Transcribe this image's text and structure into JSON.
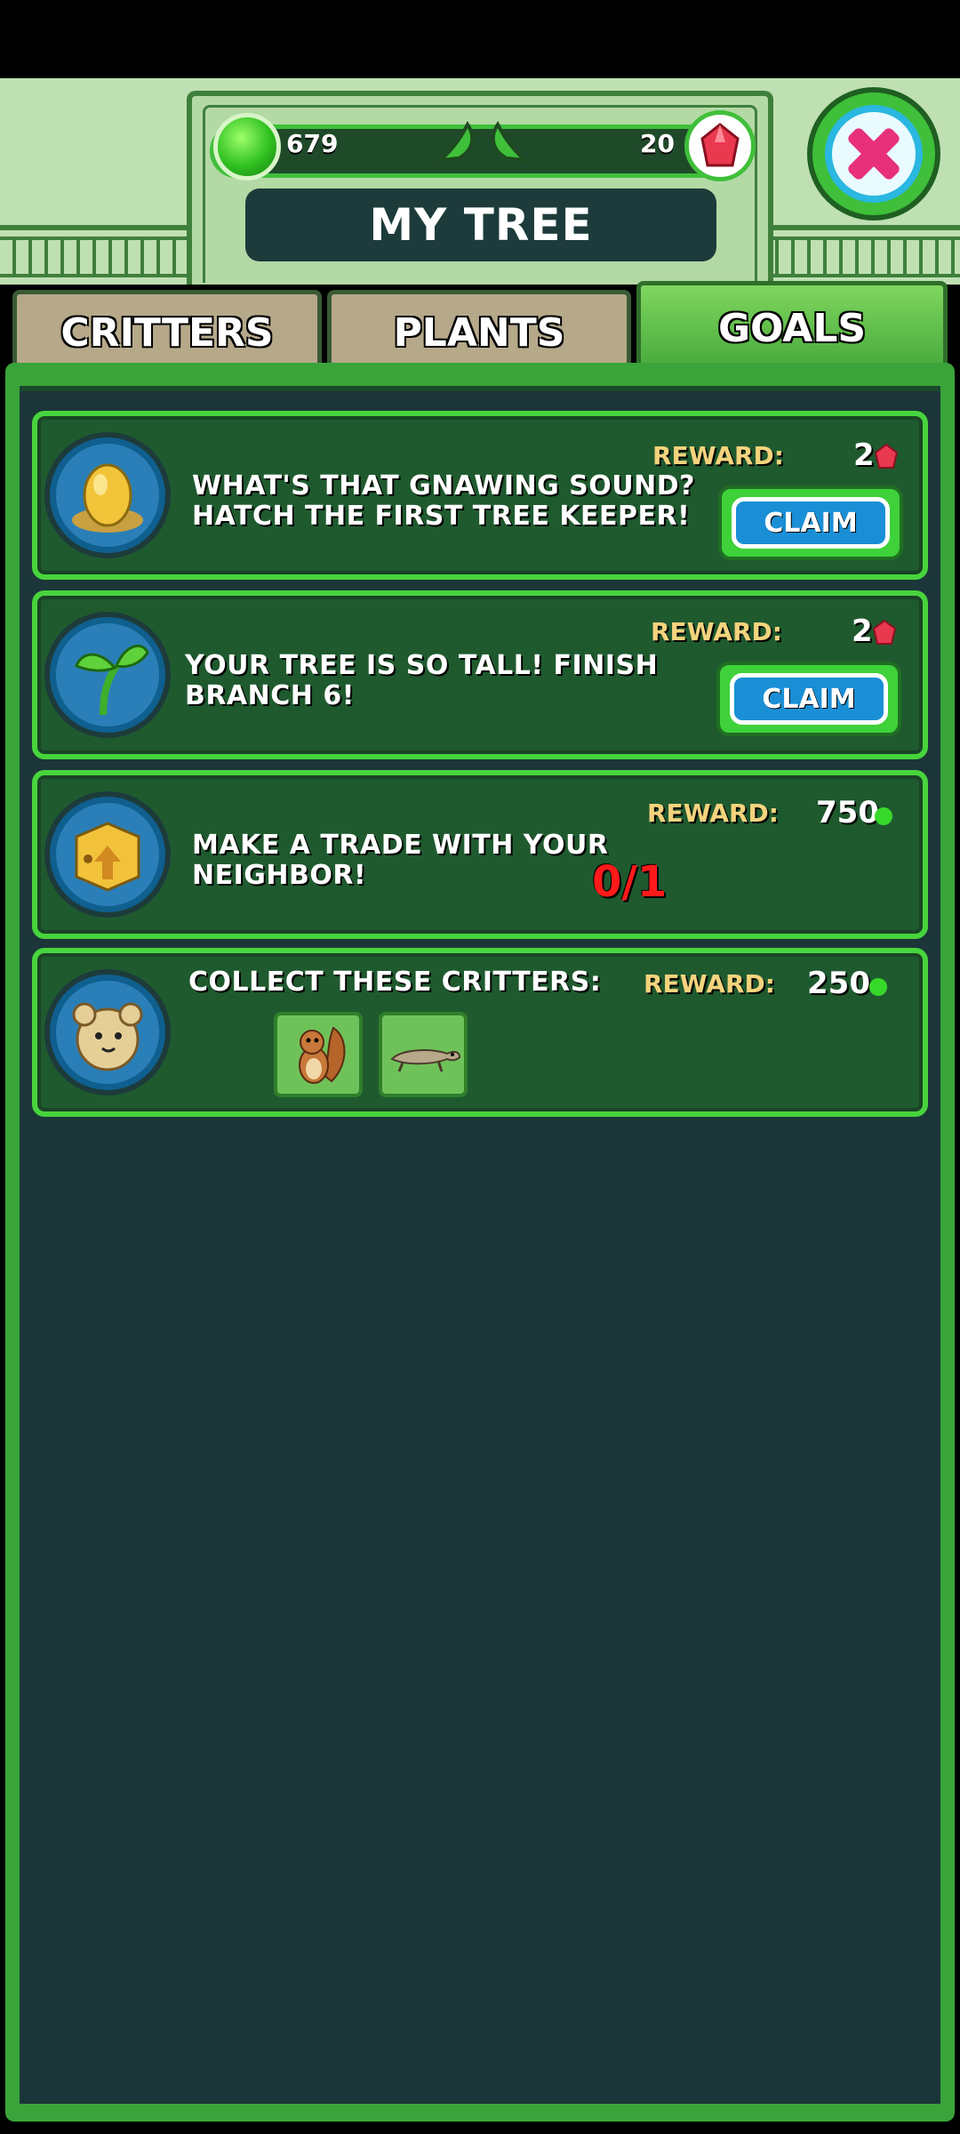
{
  "header": {
    "title": "MY TREE",
    "green_gems": "679",
    "red_gems": "20"
  },
  "tabs": [
    {
      "label": "CRITTERS"
    },
    {
      "label": "PLANTS"
    },
    {
      "label": "GOALS",
      "active": true
    }
  ],
  "goals": [
    {
      "icon": "golden-egg-icon",
      "text": "WHAT'S THAT GNAWING SOUND?\nHATCH THE FIRST TREE KEEPER!",
      "reward_label": "REWARD:",
      "reward_value": "2",
      "reward_currency": "red-gem",
      "button": "CLAIM"
    },
    {
      "icon": "sprout-icon",
      "text": "YOUR TREE IS SO TALL!  FINISH\nBRANCH 6!",
      "reward_label": "REWARD:",
      "reward_value": "2",
      "reward_currency": "red-gem",
      "button": "CLAIM"
    },
    {
      "icon": "crate-icon",
      "text": "MAKE A TRADE WITH YOUR\nNEIGHBOR!",
      "reward_label": "REWARD:",
      "reward_value": "750",
      "reward_currency": "green-gem",
      "progress": "0/1"
    },
    {
      "icon": "critter-face-icon",
      "text": "COLLECT THESE CRITTERS:",
      "reward_label": "REWARD:",
      "reward_value": "250",
      "reward_currency": "green-gem",
      "critters": [
        "squirrel-icon",
        "ferret-icon"
      ]
    }
  ],
  "colors": {
    "accent_green": "#47d43c",
    "panel_dark": "#1c3538",
    "claim_blue": "#1a8fd6",
    "progress_red": "#ff1a1a",
    "reward_gold": "#f3d37d"
  }
}
